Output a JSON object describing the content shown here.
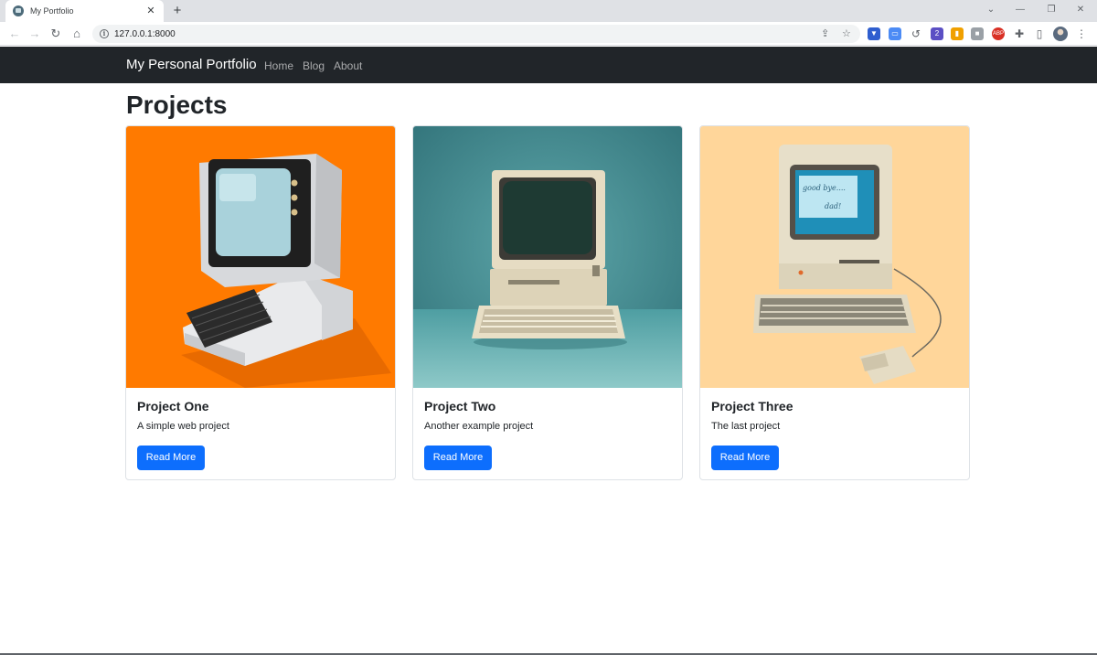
{
  "browser": {
    "tab_title": "My Portfolio",
    "tab_close": "✕",
    "new_tab": "+",
    "url": "127.0.0.1:8000",
    "ext_badge": "2",
    "adblock_label": "ABP"
  },
  "navbar": {
    "brand": "My Personal Portfolio",
    "links": [
      "Home",
      "Blog",
      "About"
    ]
  },
  "main": {
    "title": "Projects",
    "projects": [
      {
        "title": "Project One",
        "description": "A simple web project",
        "button": "Read More"
      },
      {
        "title": "Project Two",
        "description": "Another example project",
        "button": "Read More"
      },
      {
        "title": "Project Three",
        "description": "The last project",
        "button": "Read More"
      }
    ]
  },
  "screen_text": {
    "line1": "good bye....",
    "line2": "dad!"
  },
  "colors": {
    "navbar_bg": "#212529",
    "primary": "#0d6efd",
    "card_one_bg": "#ff7a00",
    "card_two_bg": "#3d8a8e",
    "card_three_bg": "#ffd69a"
  }
}
